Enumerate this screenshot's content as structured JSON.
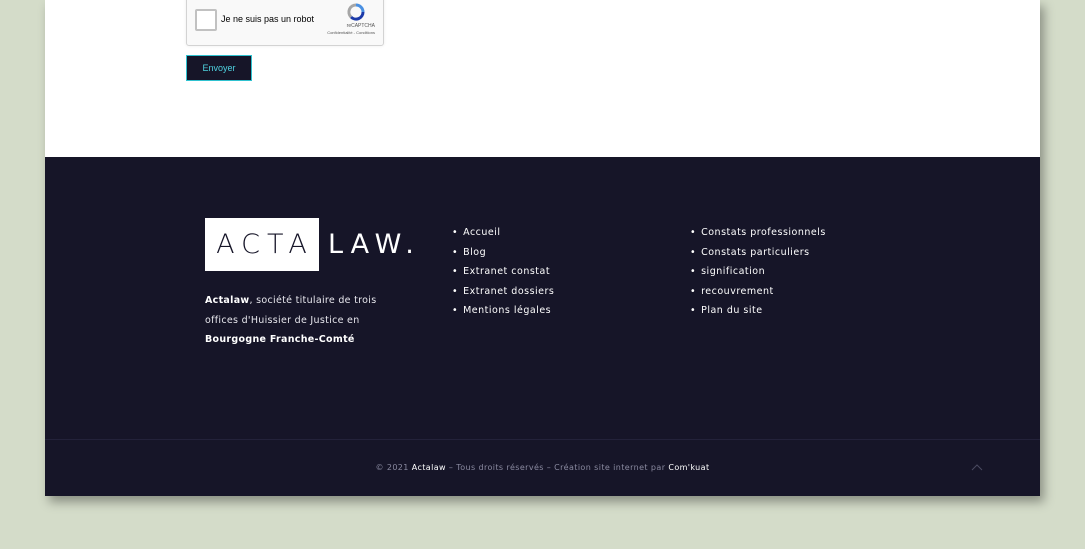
{
  "recaptcha": {
    "label": "Je ne suis pas un robot",
    "brand": "reCAPTCHA",
    "legal": "Confidentialité - Conditions"
  },
  "form": {
    "submit_label": "Envoyer"
  },
  "footer": {
    "logo_part1": "ACTA",
    "logo_part2": "LAW.",
    "about": {
      "company": "Actalaw",
      "text1": ", société titulaire de trois offices d'Huissier de Justice en ",
      "region": "Bourgogne Franche-Comté"
    },
    "nav_col1": [
      "Accueil",
      "Blog",
      "Extranet constat",
      "Extranet dossiers",
      "Mentions légales"
    ],
    "nav_col2": [
      "Constats professionnels",
      "Constats particuliers",
      "signification",
      "recouvrement",
      "Plan du site"
    ],
    "copyright": {
      "prefix": "© 2021 ",
      "company": "Actalaw",
      "middle": " – Tous droits réservés – Création site internet par ",
      "agency": "Com'kuat"
    }
  },
  "colors": {
    "footer_bg": "#161528",
    "accent": "#2fc2d0",
    "page_bg": "#d4dcc9"
  }
}
